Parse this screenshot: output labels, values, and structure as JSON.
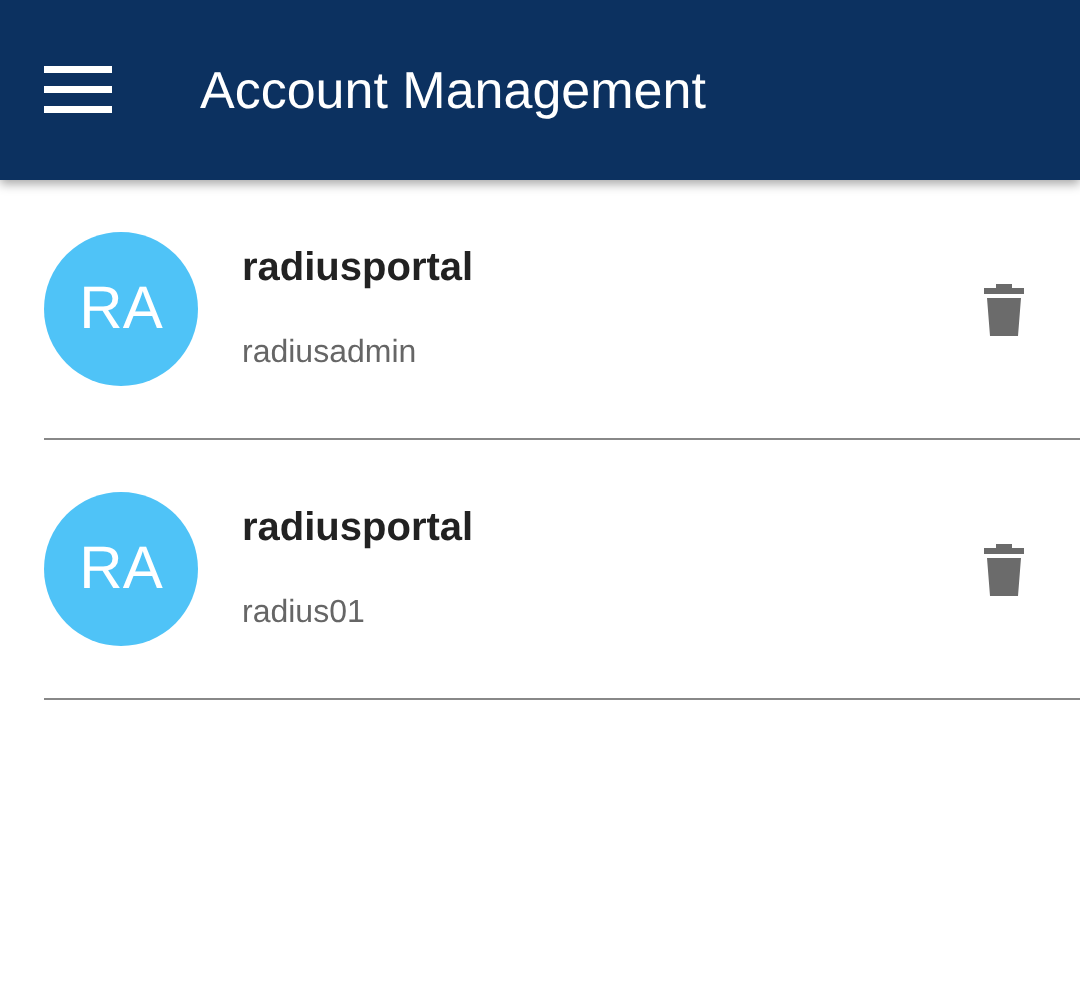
{
  "app_bar": {
    "title": "Account Management"
  },
  "accounts": [
    {
      "initials": "RA",
      "name": "radiusportal",
      "username": "radiusadmin"
    },
    {
      "initials": "RA",
      "name": "radiusportal",
      "username": "radius01"
    }
  ]
}
